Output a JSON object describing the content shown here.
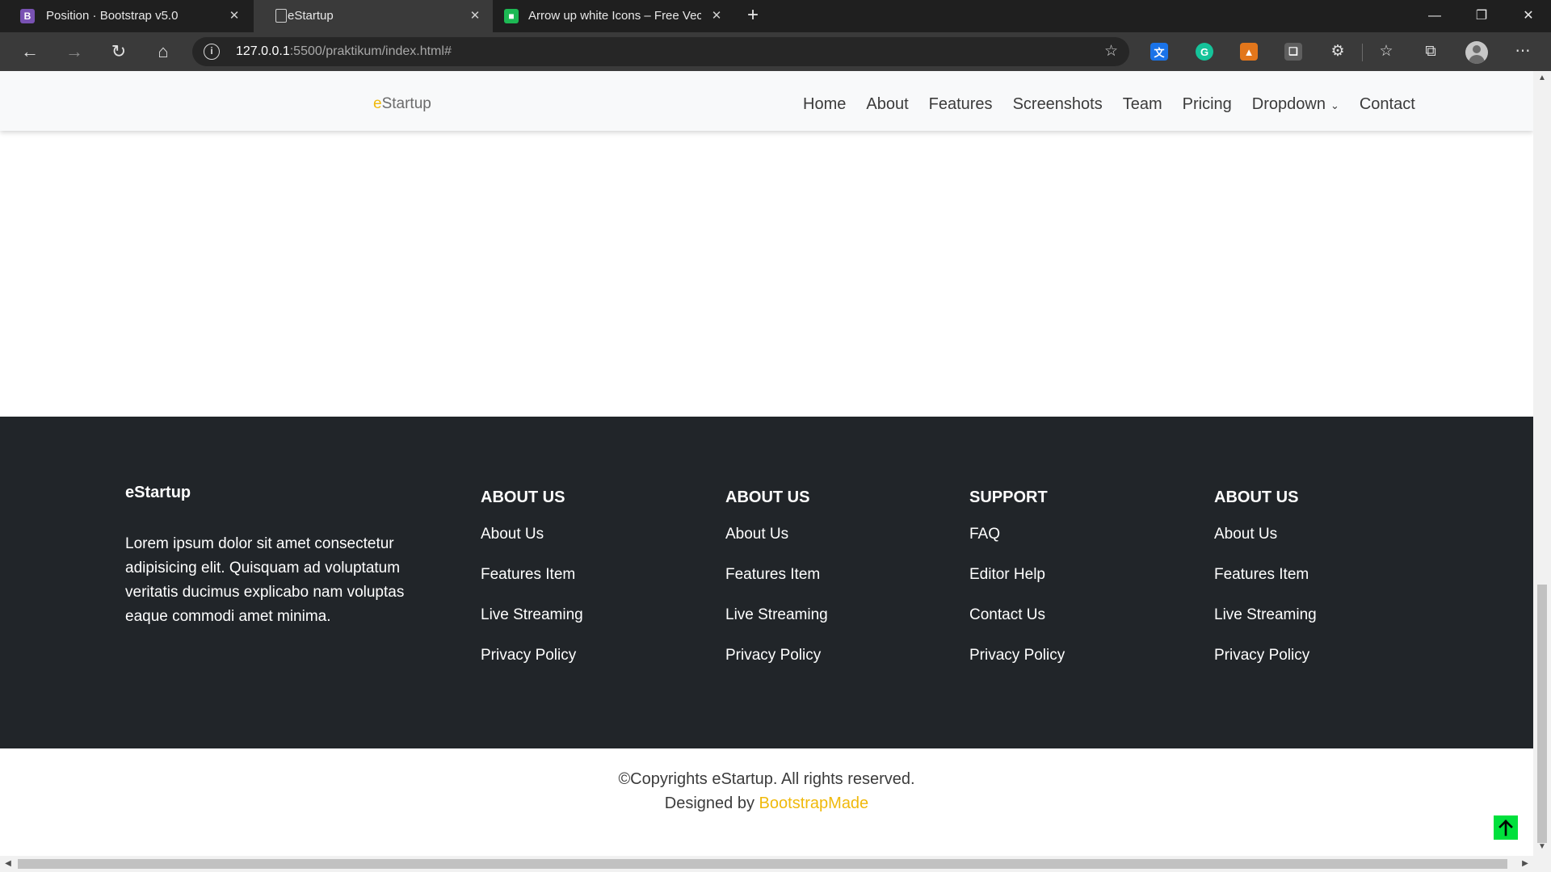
{
  "browser": {
    "tabs": [
      {
        "title": "Position · Bootstrap v5.0",
        "favicon_letter": "B",
        "favicon_color": "#7952b3"
      },
      {
        "title": "eStartup",
        "favicon_letter": "",
        "favicon_color": "#3a3a3a"
      },
      {
        "title": "Arrow up white Icons – Free Vect",
        "favicon_letter": "■",
        "favicon_color": "#1db954"
      }
    ],
    "active_tab": 1,
    "url_host": "127.0.0.1",
    "url_rest": ":5500/praktikum/index.html#",
    "extension_icons": [
      "translate-icon",
      "grammarly-icon",
      "metamask-icon",
      "copy-icon",
      "puzzle-icon",
      "favorites-icon",
      "collections-icon"
    ]
  },
  "page": {
    "brand_accent": "e",
    "brand_rest": "Startup",
    "nav": [
      {
        "label": "Home"
      },
      {
        "label": "About"
      },
      {
        "label": "Features"
      },
      {
        "label": "Screenshots"
      },
      {
        "label": "Team"
      },
      {
        "label": "Pricing"
      },
      {
        "label": "Dropdown"
      },
      {
        "label": "Contact"
      }
    ],
    "footer": {
      "brand": "eStartup",
      "description": "Lorem ipsum dolor sit amet consectetur adipisicing elit. Quisquam ad voluptatum veritatis ducimus explicabo nam voluptas eaque commodi amet minima.",
      "columns": [
        {
          "heading": "ABOUT US",
          "links": [
            "About Us",
            "Features Item",
            "Live Streaming",
            "Privacy Policy"
          ]
        },
        {
          "heading": "ABOUT US",
          "links": [
            "About Us",
            "Features Item",
            "Live Streaming",
            "Privacy Policy"
          ]
        },
        {
          "heading": "SUPPORT",
          "links": [
            "FAQ",
            "Editor Help",
            "Contact Us",
            "Privacy Policy"
          ]
        },
        {
          "heading": "ABOUT US",
          "links": [
            "About Us",
            "Features Item",
            "Live Streaming",
            "Privacy Policy"
          ]
        }
      ]
    },
    "copyright_line": "©Copyrights eStartup. All rights reserved.",
    "designed_by_prefix": "Designed by ",
    "designed_by_link": "BootstrapMade"
  },
  "colors": {
    "accent": "#f0b90b",
    "footer_bg": "#212529",
    "navbar_bg": "#f8f9fa",
    "to_top_bg": "#00e03c"
  }
}
